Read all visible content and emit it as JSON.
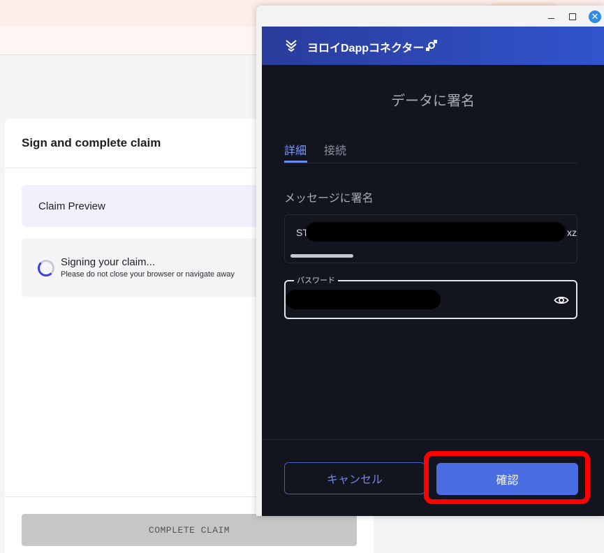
{
  "background": {
    "card_title": "Sign and complete claim",
    "preview_label": "Claim Preview",
    "signing_title": "Signing your claim...",
    "signing_subtitle": "Please do not close your browser or navigate away",
    "complete_button": "COMPLETE CLAIM"
  },
  "window": {
    "close_glyph": "✕"
  },
  "popup": {
    "header_title": "ヨロイDappコネクター",
    "page_title": "データに署名",
    "tabs": [
      {
        "label": "詳細",
        "active": true
      },
      {
        "label": "接続",
        "active": false
      }
    ],
    "message_label": "メッセージに署名",
    "message_start": "ST",
    "message_end": "xzl",
    "password_label": "パスワード",
    "cancel_button": "キャンセル",
    "confirm_button": "確認"
  },
  "icons": {
    "logo": "yoroi-logo-icon",
    "connector": "connector-icon",
    "visibility": "eye-icon"
  },
  "colors": {
    "header_gradient_start": "#2a3c9b",
    "header_gradient_end": "#3154cd",
    "app_background": "#13151e",
    "accent": "#6f88ef",
    "confirm_button": "#4b6de2",
    "highlight": "#ff0000"
  }
}
